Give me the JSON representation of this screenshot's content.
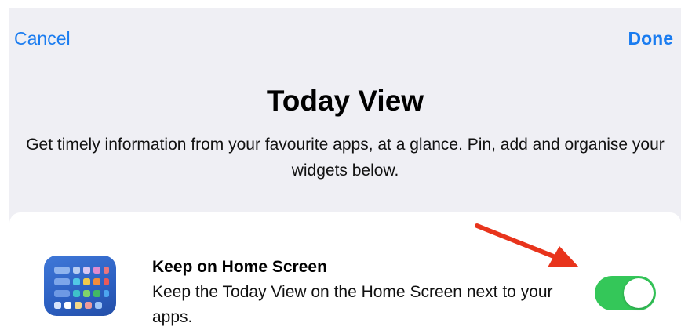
{
  "nav": {
    "cancel_label": "Cancel",
    "done_label": "Done"
  },
  "header": {
    "title": "Today View",
    "subtitle": "Get timely information from your favourite apps, at a glance. Pin, add and organise your widgets below."
  },
  "setting": {
    "title": "Keep on Home Screen",
    "description": "Keep the Today View on the Home Screen next to your apps.",
    "enabled": true,
    "icon": "home-screen-widgets-icon"
  },
  "colors": {
    "accent": "#1a7cf0",
    "toggle_on": "#34c759",
    "annotation_arrow": "#e8341c"
  }
}
